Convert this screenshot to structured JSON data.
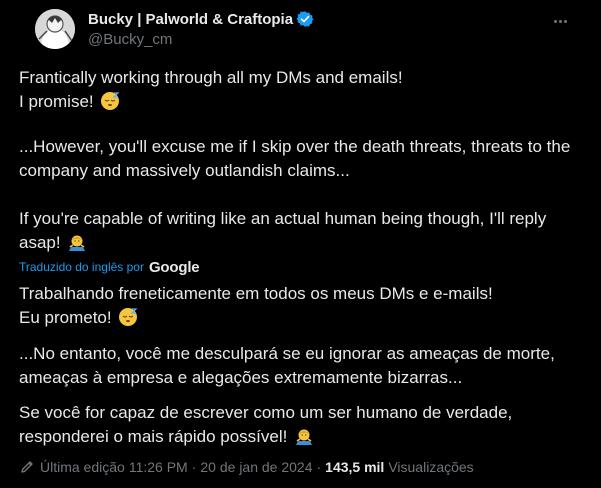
{
  "author": {
    "display_name": "Bucky | Palworld & Craftopia",
    "handle": "@Bucky_cm",
    "avatar_icon": "avatar-photo",
    "verified_icon": "verified-badge-icon"
  },
  "post": {
    "paragraph1_line1": "Frantically working through all my DMs and emails!",
    "paragraph1_line2": "I promise!",
    "paragraph2_line1": "...However, you'll excuse me if I skip over the death threats, threats to the",
    "paragraph2_line2": "company and massively outlandish claims...",
    "paragraph3_line1": "If you're capable of writing like an actual human being though, I'll reply",
    "paragraph3_line2": "asap!"
  },
  "translation": {
    "label": "Traduzido do inglês por",
    "provider": "Google",
    "paragraph1_line1": "Trabalhando freneticamente em todos os meus DMs e e-mails!",
    "paragraph1_line2": "Eu prometo!",
    "paragraph2_line1": "...No entanto, você me desculpará se eu ignorar as ameaças de morte,",
    "paragraph2_line2": "ameaças à empresa e alegações extremamente bizarras...",
    "paragraph3_line1": "Se você for capaz de escrever como um ser humano de verdade,",
    "paragraph3_line2": "responderei o mais rápido possível!"
  },
  "footer": {
    "edited_label": "Última edição",
    "time": "11:26 PM",
    "separator1": "·",
    "date": "20 de jan de 2024",
    "separator2": "·",
    "views_count": "143,5 mil",
    "views_label": "Visualizações"
  },
  "colors": {
    "background": "#000000",
    "text": "#e7e9ea",
    "secondary": "#71767b",
    "accent": "#1d9bf0"
  }
}
